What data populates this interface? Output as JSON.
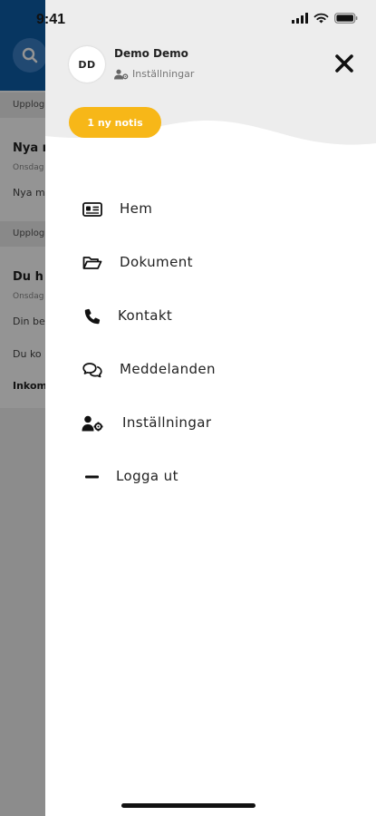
{
  "status_bar": {
    "time": "9:41"
  },
  "background": {
    "section1_label": "Upplog",
    "item1_title": "Nya r",
    "item1_date": "Onsdag",
    "item1_body": "Nya m",
    "section2_label": "Upplog",
    "item2_title": "Du h",
    "item2_date": "Onsdag",
    "item2_body1": "Din be",
    "item2_body2": "Du ko",
    "item2_body3": "Inkom"
  },
  "drawer": {
    "user": {
      "initials": "DD",
      "name": "Demo Demo",
      "settings_link": "Inställningar"
    },
    "notification_pill": "1 ny notis",
    "menu": [
      {
        "label": "Hem",
        "icon": "id-card-icon"
      },
      {
        "label": "Dokument",
        "icon": "folder-open-icon"
      },
      {
        "label": "Kontakt",
        "icon": "phone-icon"
      },
      {
        "label": "Meddelanden",
        "icon": "chat-bubbles-icon"
      },
      {
        "label": "Inställningar",
        "icon": "user-cog-icon"
      },
      {
        "label": "Logga ut",
        "icon": "minus-icon"
      }
    ]
  },
  "colors": {
    "accent_yellow": "#f7b718",
    "header_blue": "#0d5da8",
    "drawer_header_gray": "#ededed"
  }
}
